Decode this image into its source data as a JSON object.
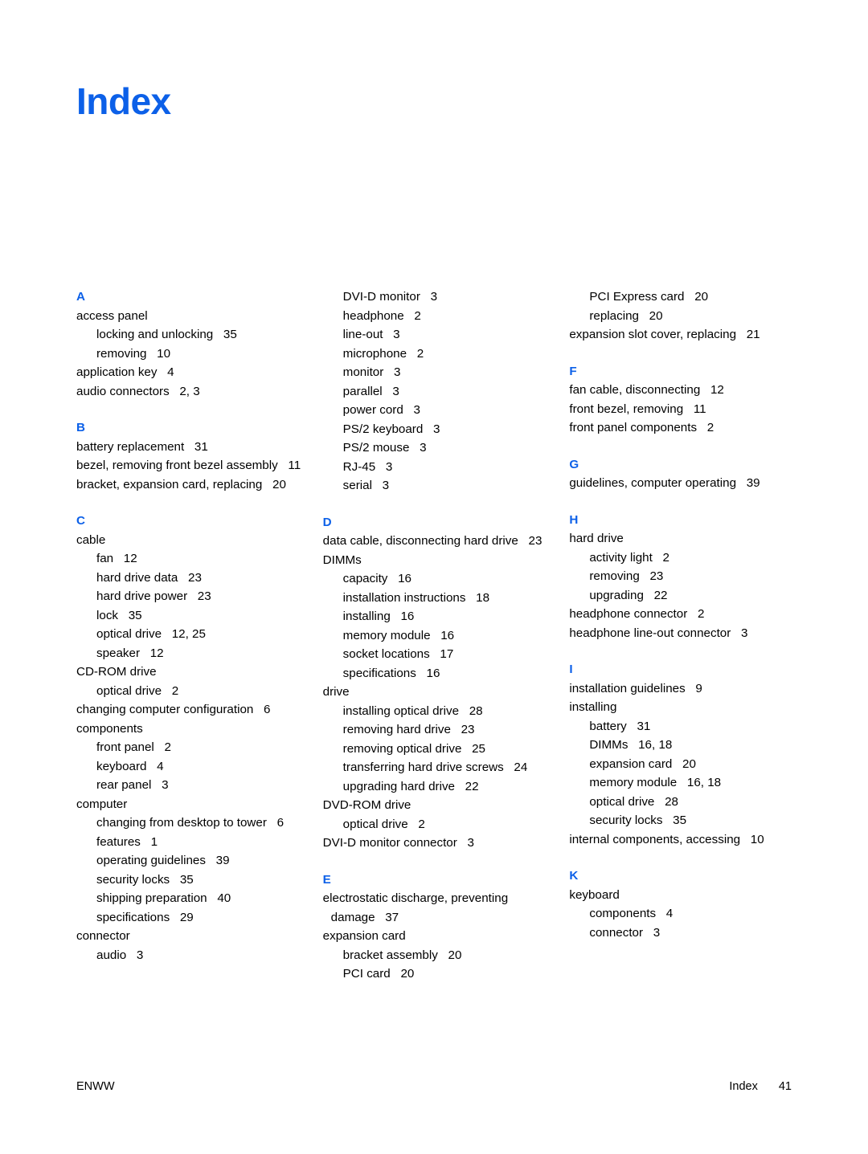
{
  "document": {
    "title": "Index",
    "title_color": "#0c60e8",
    "heading_color": "#0c60e8",
    "text_color": "#000000",
    "background": "#ffffff"
  },
  "footer": {
    "left_label": "ENWW",
    "section_label": "Index",
    "page_number": "41"
  },
  "columns": [
    {
      "groups": [
        {
          "letter": "A",
          "entries": [
            {
              "level": "main",
              "text": "access panel",
              "locator": ""
            },
            {
              "level": "sub",
              "text": "locking and unlocking",
              "locator": "35"
            },
            {
              "level": "sub",
              "text": "removing",
              "locator": "10"
            },
            {
              "level": "main",
              "text": "application key",
              "locator": "4"
            },
            {
              "level": "main",
              "text": "audio connectors",
              "locator": "2, 3"
            }
          ]
        },
        {
          "letter": "B",
          "entries": [
            {
              "level": "main",
              "text": "battery replacement",
              "locator": "31"
            },
            {
              "level": "main",
              "text": "bezel, removing front bezel assembly",
              "locator": "11"
            },
            {
              "level": "main",
              "text": "bracket, expansion card, replacing",
              "locator": "20"
            }
          ]
        },
        {
          "letter": "C",
          "entries": [
            {
              "level": "main",
              "text": "cable",
              "locator": ""
            },
            {
              "level": "sub",
              "text": "fan",
              "locator": "12"
            },
            {
              "level": "sub",
              "text": "hard drive data",
              "locator": "23"
            },
            {
              "level": "sub",
              "text": "hard drive power",
              "locator": "23"
            },
            {
              "level": "sub",
              "text": "lock",
              "locator": "35"
            },
            {
              "level": "sub",
              "text": "optical drive",
              "locator": "12, 25"
            },
            {
              "level": "sub",
              "text": "speaker",
              "locator": "12"
            },
            {
              "level": "main",
              "text": "CD-ROM drive",
              "locator": ""
            },
            {
              "level": "sub",
              "text": "optical drive",
              "locator": "2"
            },
            {
              "level": "main",
              "text": "changing computer configuration",
              "locator": "6"
            },
            {
              "level": "main",
              "text": "components",
              "locator": ""
            },
            {
              "level": "sub",
              "text": "front panel",
              "locator": "2"
            },
            {
              "level": "sub",
              "text": "keyboard",
              "locator": "4"
            },
            {
              "level": "sub",
              "text": "rear panel",
              "locator": "3"
            },
            {
              "level": "main",
              "text": "computer",
              "locator": ""
            },
            {
              "level": "sub",
              "text": "changing from desktop to tower",
              "locator": "6"
            },
            {
              "level": "sub",
              "text": "features",
              "locator": "1"
            },
            {
              "level": "sub",
              "text": "operating guidelines",
              "locator": "39"
            },
            {
              "level": "sub",
              "text": "security locks",
              "locator": "35"
            },
            {
              "level": "sub",
              "text": "shipping preparation",
              "locator": "40"
            },
            {
              "level": "sub",
              "text": "specifications",
              "locator": "29"
            },
            {
              "level": "main",
              "text": "connector",
              "locator": ""
            },
            {
              "level": "sub",
              "text": "audio",
              "locator": "3"
            }
          ]
        }
      ]
    },
    {
      "groups": [
        {
          "letter": "",
          "entries": [
            {
              "level": "sub",
              "text": "DVI-D monitor",
              "locator": "3"
            },
            {
              "level": "sub",
              "text": "headphone",
              "locator": "2"
            },
            {
              "level": "sub",
              "text": "line-out",
              "locator": "3"
            },
            {
              "level": "sub",
              "text": "microphone",
              "locator": "2"
            },
            {
              "level": "sub",
              "text": "monitor",
              "locator": "3"
            },
            {
              "level": "sub",
              "text": "parallel",
              "locator": "3"
            },
            {
              "level": "sub",
              "text": "power cord",
              "locator": "3"
            },
            {
              "level": "sub",
              "text": "PS/2 keyboard",
              "locator": "3"
            },
            {
              "level": "sub",
              "text": "PS/2 mouse",
              "locator": "3"
            },
            {
              "level": "sub",
              "text": "RJ-45",
              "locator": "3"
            },
            {
              "level": "sub",
              "text": "serial",
              "locator": "3"
            }
          ]
        },
        {
          "letter": "D",
          "entries": [
            {
              "level": "main",
              "text": "data cable, disconnecting hard drive",
              "locator": "23"
            },
            {
              "level": "main",
              "text": "DIMMs",
              "locator": ""
            },
            {
              "level": "sub",
              "text": "capacity",
              "locator": "16"
            },
            {
              "level": "sub",
              "text": "installation instructions",
              "locator": "18"
            },
            {
              "level": "sub",
              "text": "installing",
              "locator": "16"
            },
            {
              "level": "sub",
              "text": "memory module",
              "locator": "16"
            },
            {
              "level": "sub",
              "text": "socket locations",
              "locator": "17"
            },
            {
              "level": "sub",
              "text": "specifications",
              "locator": "16"
            },
            {
              "level": "main",
              "text": "drive",
              "locator": ""
            },
            {
              "level": "sub",
              "text": "installing optical drive",
              "locator": "28"
            },
            {
              "level": "sub",
              "text": "removing hard drive",
              "locator": "23"
            },
            {
              "level": "sub",
              "text": "removing optical drive",
              "locator": "25"
            },
            {
              "level": "sub",
              "text": "transferring hard drive screws",
              "locator": "24"
            },
            {
              "level": "sub",
              "text": "upgrading hard drive",
              "locator": "22"
            },
            {
              "level": "main",
              "text": "DVD-ROM drive",
              "locator": ""
            },
            {
              "level": "sub",
              "text": "optical drive",
              "locator": "2"
            },
            {
              "level": "main",
              "text": "DVI-D monitor connector",
              "locator": "3"
            }
          ]
        },
        {
          "letter": "E",
          "entries": [
            {
              "level": "main",
              "text": "electrostatic discharge, preventing damage",
              "locator": "37"
            },
            {
              "level": "main",
              "text": "expansion card",
              "locator": ""
            },
            {
              "level": "sub",
              "text": "bracket assembly",
              "locator": "20"
            },
            {
              "level": "sub",
              "text": "PCI card",
              "locator": "20"
            }
          ]
        }
      ]
    },
    {
      "groups": [
        {
          "letter": "",
          "entries": [
            {
              "level": "sub",
              "text": "PCI Express card",
              "locator": "20"
            },
            {
              "level": "sub",
              "text": "replacing",
              "locator": "20"
            },
            {
              "level": "main",
              "text": "expansion slot cover, replacing",
              "locator": "21"
            }
          ]
        },
        {
          "letter": "F",
          "entries": [
            {
              "level": "main",
              "text": "fan cable, disconnecting",
              "locator": "12"
            },
            {
              "level": "main",
              "text": "front bezel, removing",
              "locator": "11"
            },
            {
              "level": "main",
              "text": "front panel components",
              "locator": "2"
            }
          ]
        },
        {
          "letter": "G",
          "entries": [
            {
              "level": "main",
              "text": "guidelines, computer operating",
              "locator": "39"
            }
          ]
        },
        {
          "letter": "H",
          "entries": [
            {
              "level": "main",
              "text": "hard drive",
              "locator": ""
            },
            {
              "level": "sub",
              "text": "activity light",
              "locator": "2"
            },
            {
              "level": "sub",
              "text": "removing",
              "locator": "23"
            },
            {
              "level": "sub",
              "text": "upgrading",
              "locator": "22"
            },
            {
              "level": "main",
              "text": "headphone connector",
              "locator": "2"
            },
            {
              "level": "main",
              "text": "headphone line-out connector",
              "locator": "3"
            }
          ]
        },
        {
          "letter": "I",
          "entries": [
            {
              "level": "main",
              "text": "installation guidelines",
              "locator": "9"
            },
            {
              "level": "main",
              "text": "installing",
              "locator": ""
            },
            {
              "level": "sub",
              "text": "battery",
              "locator": "31"
            },
            {
              "level": "sub",
              "text": "DIMMs",
              "locator": "16, 18"
            },
            {
              "level": "sub",
              "text": "expansion card",
              "locator": "20"
            },
            {
              "level": "sub",
              "text": "memory module",
              "locator": "16, 18"
            },
            {
              "level": "sub",
              "text": "optical drive",
              "locator": "28"
            },
            {
              "level": "sub",
              "text": "security locks",
              "locator": "35"
            },
            {
              "level": "main",
              "text": "internal components, accessing",
              "locator": "10"
            }
          ]
        },
        {
          "letter": "K",
          "entries": [
            {
              "level": "main",
              "text": "keyboard",
              "locator": ""
            },
            {
              "level": "sub",
              "text": "components",
              "locator": "4"
            },
            {
              "level": "sub",
              "text": "connector",
              "locator": "3"
            }
          ]
        }
      ]
    }
  ]
}
